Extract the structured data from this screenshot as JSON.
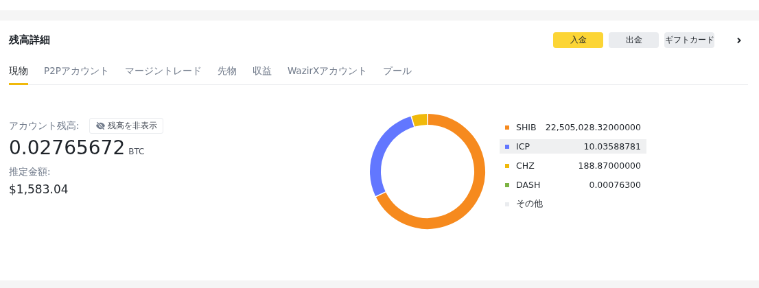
{
  "title": "残高詳細",
  "actions": [
    {
      "label": "入金",
      "kind": "primary"
    },
    {
      "label": "出金",
      "kind": "secondary"
    },
    {
      "label": "ギフトカード",
      "kind": "secondary"
    }
  ],
  "tabs": [
    {
      "label": "現物",
      "selected": true
    },
    {
      "label": "P2Pアカウント",
      "selected": false
    },
    {
      "label": "マージントレード",
      "selected": false
    },
    {
      "label": "先物",
      "selected": false
    },
    {
      "label": "収益",
      "selected": false
    },
    {
      "label": "WazirXアカウント",
      "selected": false
    },
    {
      "label": "プール",
      "selected": false
    }
  ],
  "balance": {
    "label": "アカウント残高:",
    "hide_button": "残高を非表示",
    "amount": "0.02765672",
    "unit": "BTC",
    "estimate_label": "推定金額:",
    "estimate": "$1,583.04"
  },
  "legend": [
    {
      "name": "SHIB",
      "amount": "22,505,028.32000000",
      "color": "#f68a1e",
      "selected": false
    },
    {
      "name": "ICP",
      "amount": "10.03588781",
      "color": "#6277ff",
      "selected": true
    },
    {
      "name": "CHZ",
      "amount": "188.87000000",
      "color": "#f0b90b",
      "selected": false
    },
    {
      "name": "DASH",
      "amount": "0.00076300",
      "color": "#7cb342",
      "selected": false
    },
    {
      "name": "その他",
      "color": "#eaecef",
      "selected": false
    }
  ]
}
